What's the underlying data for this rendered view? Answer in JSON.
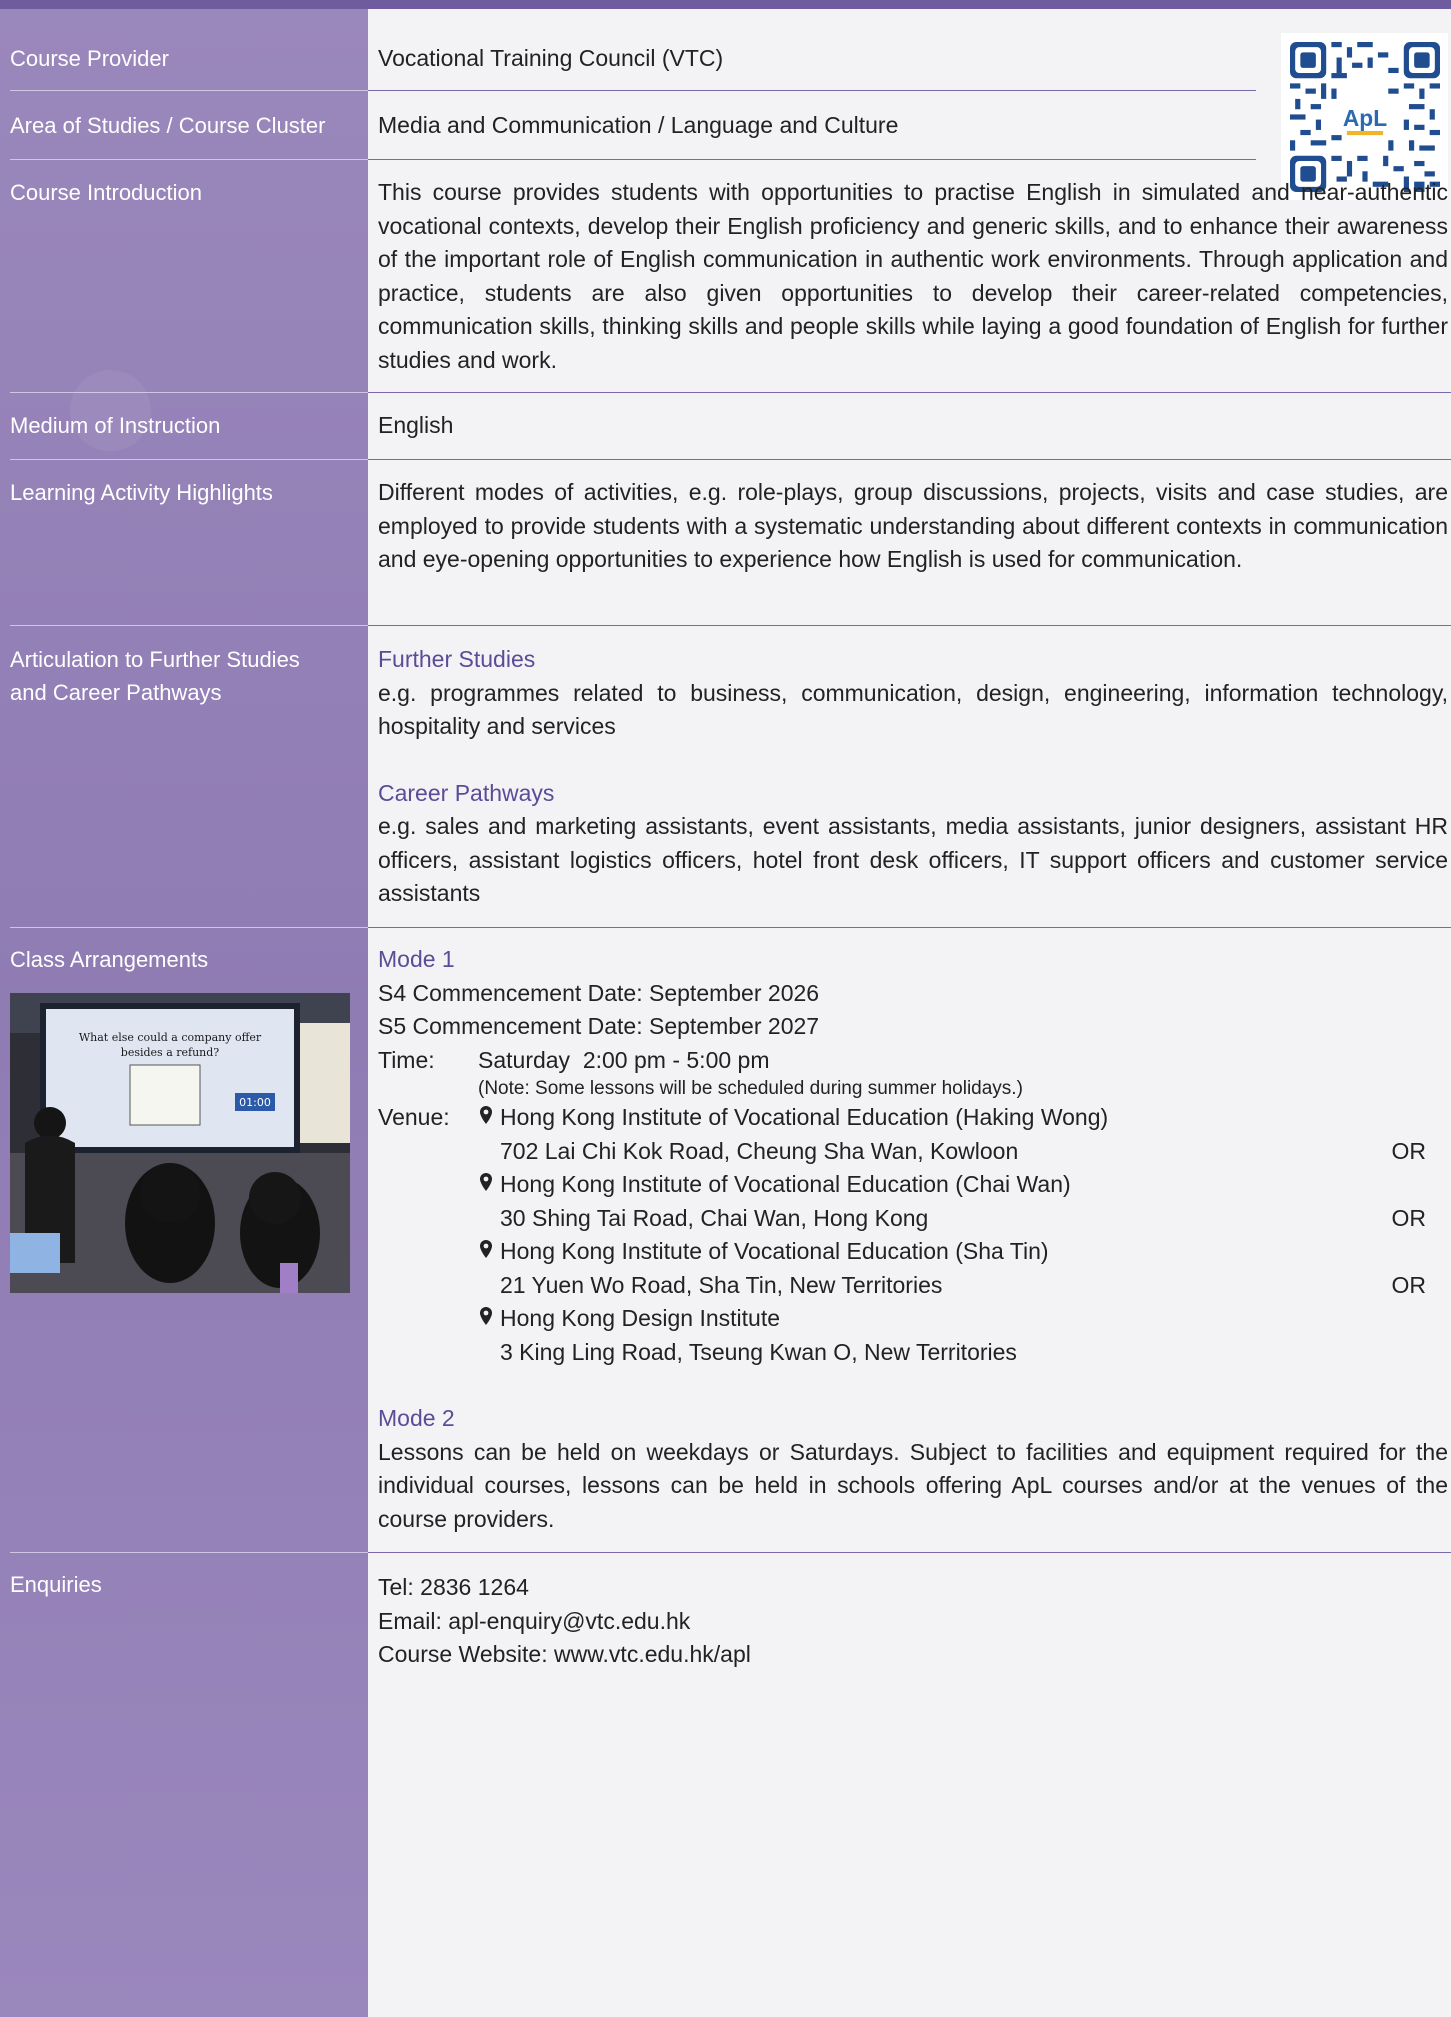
{
  "labels": {
    "provider": "Course Provider",
    "area": "Area of Studies / Course Cluster",
    "intro": "Course Introduction",
    "medium": "Medium of Instruction",
    "highlights": "Learning Activity Highlights",
    "articulation_1": "Articulation to Further Studies",
    "articulation_2": "and Career Pathways",
    "class": "Class Arrangements",
    "enquiries": "Enquiries"
  },
  "provider": "Vocational Training Council (VTC)",
  "area": "Media and Communication / Language and Culture",
  "intro": "This course provides students with opportunities to practise English in simulated and near-authentic vocational contexts, develop their English proficiency and generic skills, and to enhance their awareness of the important role of English communication in authentic work environments. Through application and practice, students are also given opportunities to develop their career-related competencies, communication skills, thinking skills and people skills while laying a good foundation of English for further studies and work.",
  "medium": "English",
  "highlights": "Different modes of activities, e.g. role-plays, group discussions, projects, visits and case studies, are employed to provide students with a systematic understanding about different contexts in communication and eye-opening opportunities to experience how English is used for communication.",
  "articulation": {
    "further_title": "Further Studies",
    "further_text": "e.g. programmes related to business, communication, design, engineering, information technology, hospitality and services",
    "career_title": "Career Pathways",
    "career_text": "e.g. sales and marketing assistants, event assistants, media assistants, junior designers, assistant HR officers, assistant logistics officers, hotel front desk officers, IT support officers and customer service assistants"
  },
  "class": {
    "mode1_title": "Mode 1",
    "s4": "S4 Commencement Date: September 2026",
    "s5": "S5 Commencement Date: September 2027",
    "time_key": "Time:",
    "time_val": "Saturday  2:00 pm - 5:00 pm",
    "note": "(Note: Some lessons will be scheduled during summer holidays.)",
    "venue_key": "Venue:",
    "venues": [
      {
        "name": "Hong Kong Institute of Vocational Education (Haking Wong)",
        "addr": "702 Lai Chi Kok Road, Cheung Sha Wan, Kowloon",
        "or": "OR"
      },
      {
        "name": "Hong Kong Institute of Vocational Education (Chai Wan)",
        "addr": "30 Shing Tai Road, Chai Wan, Hong Kong",
        "or": "OR"
      },
      {
        "name": "Hong Kong Institute of Vocational Education (Sha Tin)",
        "addr": "21 Yuen Wo Road, Sha Tin, New Territories",
        "or": "OR"
      },
      {
        "name": "Hong Kong Design Institute",
        "addr": "3 King Ling Road, Tseung Kwan O, New Territories",
        "or": ""
      }
    ],
    "mode2_title": "Mode 2",
    "mode2_text": "Lessons can be held on weekdays or Saturdays. Subject to facilities and equipment required for the individual courses, lessons can be held in schools offering ApL courses and/or at the venues of the course providers."
  },
  "photo": {
    "screen_line1": "What else could a company offer",
    "screen_line2": "besides a refund?",
    "timer": "01:00"
  },
  "qr": {
    "badge": "ApL"
  },
  "enquiries": {
    "tel": "Tel: 2836 1264",
    "email": "Email: apl-enquiry@vtc.edu.hk",
    "website": "Course Website: www.vtc.edu.hk/apl"
  },
  "colors": {
    "sidebar": "#9481b7",
    "accent": "#5c4b96",
    "topbar": "#6f5c9f"
  }
}
